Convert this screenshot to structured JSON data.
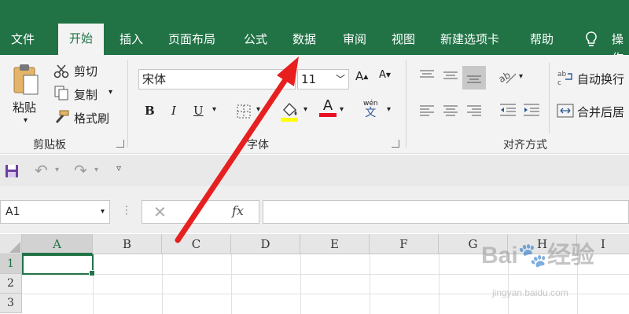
{
  "tabs": [
    {
      "label": "文件",
      "active": false
    },
    {
      "label": "开始",
      "active": true
    },
    {
      "label": "插入",
      "active": false
    },
    {
      "label": "页面布局",
      "active": false
    },
    {
      "label": "公式",
      "active": false
    },
    {
      "label": "数据",
      "active": false
    },
    {
      "label": "审阅",
      "active": false
    },
    {
      "label": "视图",
      "active": false
    },
    {
      "label": "新建选项卡",
      "active": false
    },
    {
      "label": "帮助",
      "active": false
    },
    {
      "label": "操作",
      "active": false
    }
  ],
  "clipboard": {
    "paste": "粘贴",
    "cut": "剪切",
    "copy": "复制",
    "format_painter": "格式刷",
    "group_label": "剪贴板"
  },
  "font": {
    "name": "宋体",
    "size": "11",
    "bold": "B",
    "italic": "I",
    "underline": "U",
    "font_color_letter": "A",
    "phonetic_top": "wén",
    "phonetic_char": "文",
    "group_label": "字体"
  },
  "alignment": {
    "wrap_text": "自动换行",
    "merge_center": "合并后居",
    "group_label": "对齐方式"
  },
  "formula_bar": {
    "name_box": "A1",
    "fx": "fx"
  },
  "grid": {
    "columns": [
      "A",
      "B",
      "C",
      "D",
      "E",
      "F",
      "G",
      "H",
      "I"
    ],
    "rows": [
      "1",
      "2",
      "3"
    ],
    "selected_cell": "A1"
  },
  "watermark": {
    "logo_text": "Bai",
    "logo_suffix": "经验",
    "url": "jingyan.baidu.com"
  },
  "colors": {
    "accent": "#217346",
    "highlight": "#ffff00",
    "font_color": "#e81123",
    "arrow": "#e81f1f"
  }
}
